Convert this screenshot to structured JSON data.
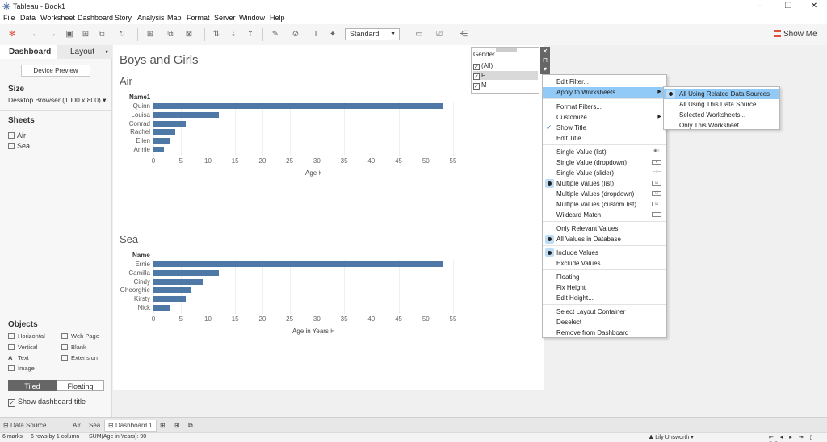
{
  "window": {
    "title": "Tableau - Book1",
    "controls": [
      "–",
      "❐",
      "✕"
    ]
  },
  "menubar": [
    "File",
    "Data",
    "Worksheet",
    "Dashboard",
    "Story",
    "Analysis",
    "Map",
    "Format",
    "Server",
    "Window",
    "Help"
  ],
  "toolbar": {
    "mark_size": "Standard",
    "show_me": "Show Me"
  },
  "left_pane": {
    "tabs": [
      "Dashboard",
      "Layout"
    ],
    "device_preview": "Device Preview",
    "size_title": "Size",
    "size_value": "Desktop Browser (1000 x 800)",
    "sheets_title": "Sheets",
    "sheets": [
      "Air",
      "Sea"
    ],
    "objects_title": "Objects",
    "objects": [
      "Horizontal",
      "Web Page",
      "Vertical",
      "Blank",
      "Text",
      "Extension",
      "Image"
    ],
    "tiled": "Tiled",
    "floating": "Floating",
    "show_title": "Show dashboard title"
  },
  "dashboard": {
    "title": "Boys and Girls",
    "air": {
      "title": "Air",
      "header": "Name1",
      "axis_title": "Age",
      "names": [
        "Quinn",
        "Louisa",
        "Conrad",
        "Rachel",
        "Ellen",
        "Annie"
      ]
    },
    "sea": {
      "title": "Sea",
      "header": "Name",
      "axis_title": "Age in Years",
      "names": [
        "Ernie",
        "Camilla",
        "Cindy",
        "Gheorghie",
        "Kirsty",
        "Nick"
      ]
    }
  },
  "chart_data": [
    {
      "type": "bar",
      "title": "Air",
      "categories": [
        "Quinn",
        "Louisa",
        "Conrad",
        "Rachel",
        "Ellen",
        "Annie"
      ],
      "values": [
        53,
        12,
        6,
        4,
        3,
        2
      ],
      "xlabel": "Age",
      "ylabel": "Name1",
      "xlim": [
        0,
        55
      ],
      "ticks": [
        0,
        5,
        10,
        15,
        20,
        25,
        30,
        35,
        40,
        45,
        50,
        55
      ]
    },
    {
      "type": "bar",
      "title": "Sea",
      "categories": [
        "Ernie",
        "Camilla",
        "Cindy",
        "Gheorghie",
        "Kirsty",
        "Nick"
      ],
      "values": [
        53,
        12,
        9,
        7,
        6,
        3
      ],
      "xlabel": "Age in Years",
      "ylabel": "Name",
      "xlim": [
        0,
        55
      ],
      "ticks": [
        0,
        5,
        10,
        15,
        20,
        25,
        30,
        35,
        40,
        45,
        50,
        55
      ]
    }
  ],
  "filter": {
    "title": "Gender",
    "options": [
      "(All)",
      "F",
      "M"
    ]
  },
  "context_menu": {
    "items": [
      "Edit Filter...",
      "Apply to Worksheets",
      "Format Filters...",
      "Customize",
      "Show Title",
      "Edit Title...",
      "Single Value (list)",
      "Single Value (dropdown)",
      "Single Value (slider)",
      "Multiple Values (list)",
      "Multiple Values (dropdown)",
      "Multiple Values (custom list)",
      "Wildcard Match",
      "Only Relevant Values",
      "All Values in Database",
      "Include Values",
      "Exclude Values",
      "Floating",
      "Fix Height",
      "Edit Height...",
      "Select Layout Container",
      "Deselect",
      "Remove from Dashboard"
    ]
  },
  "submenu": {
    "items": [
      "All Using Related Data Sources",
      "All Using This Data Source",
      "Selected Worksheets...",
      "Only This Worksheet"
    ]
  },
  "bottom_tabs": [
    "Data Source",
    "Air",
    "Sea",
    "Dashboard 1"
  ],
  "status": {
    "marks": "6 marks",
    "rows": "6 rows by 1 column",
    "sum": "SUM(Age in Years): 90",
    "user": "Lily Unsworth"
  }
}
